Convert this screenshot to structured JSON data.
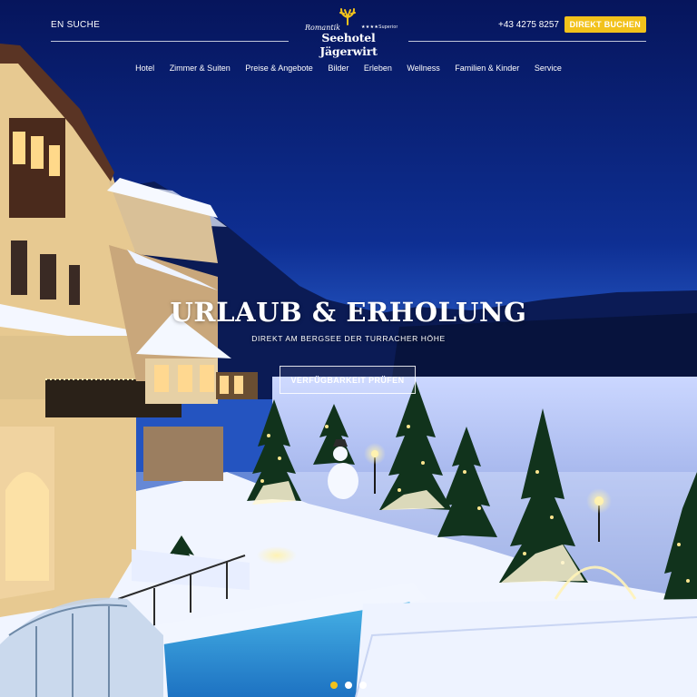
{
  "header": {
    "language": "EN SUCHE",
    "phone": "+43 4275 8257",
    "book_label": "DIREKT BUCHEN",
    "logo": {
      "prefix": "Romantik",
      "name": "Seehotel Jägerwirt",
      "stars": "★★★★Superior"
    }
  },
  "nav": {
    "items": [
      "Hotel",
      "Zimmer & Suiten",
      "Preise & Angebote",
      "Bilder",
      "Erleben",
      "Wellness",
      "Familien & Kinder",
      "Service"
    ]
  },
  "hero": {
    "title": "URLAUB & ERHOLUNG",
    "subtitle": "DIREKT AM BERGSEE DER TURRACHER HÖHE",
    "cta_label": "VERFÜGBARKEIT PRÜFEN"
  },
  "slider": {
    "count": 3,
    "active_index": 0
  },
  "colors": {
    "accent": "#f2c21b",
    "sky_top": "#05155a",
    "sky_mid": "#1b47b5",
    "snow": "#dbe6ff"
  }
}
